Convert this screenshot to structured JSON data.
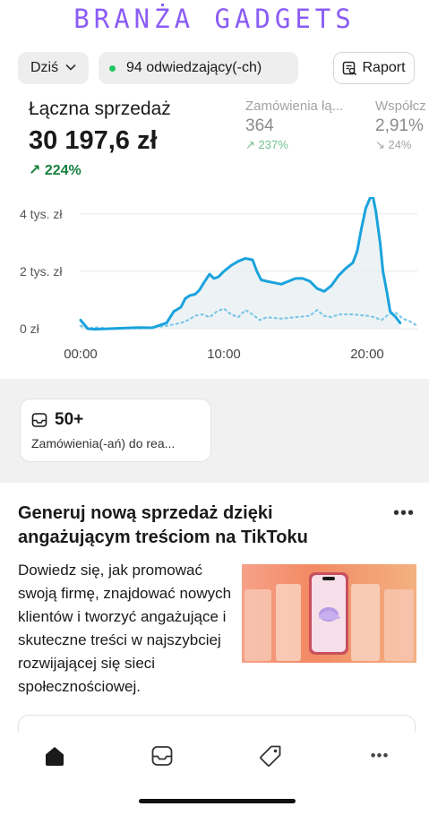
{
  "brand": "BRANŻA GADGETS",
  "toolbar": {
    "date_label": "Dziś",
    "visitors_label": "94 odwiedzający(-ch)",
    "report_label": "Raport"
  },
  "metrics": {
    "main": {
      "label": "Łączna sprzedaż",
      "value": "30 197,6 zł",
      "delta": "224%"
    },
    "orders": {
      "label": "Zamówienia łą...",
      "value": "364",
      "delta": "237%"
    },
    "conversion": {
      "label": "Współcz",
      "value": "2,91%",
      "delta": "24%"
    }
  },
  "chart_data": {
    "type": "line",
    "ytick_labels": [
      "4 tys. zł",
      "2 tys. zł",
      "0 zł"
    ],
    "yticks": [
      4000,
      2000,
      0
    ],
    "xtick_labels": [
      "00:00",
      "10:00",
      "20:00"
    ],
    "xticks": [
      0,
      10,
      20
    ],
    "xlim": [
      0,
      23.5
    ],
    "ylim": [
      0,
      4400
    ],
    "series": [
      {
        "style": "solid",
        "color": "#1ba3dd",
        "x": [
          0,
          0.5,
          1,
          2,
          3,
          4,
          5,
          6,
          6.5,
          7,
          7.3,
          7.6,
          8,
          8.3,
          8.6,
          9,
          9.3,
          9.6,
          10,
          10.5,
          11,
          11.5,
          12,
          12.3,
          12.6,
          13,
          13.5,
          14,
          14.5,
          15,
          15.5,
          16,
          16.5,
          17,
          17.5,
          18,
          18.5,
          19,
          19.3,
          19.6,
          19.9,
          20.2,
          20.4,
          20.6,
          20.9,
          21.1,
          21.4,
          21.6,
          22,
          22.3
        ],
        "y": [
          300,
          0,
          -20,
          0,
          20,
          40,
          30,
          200,
          600,
          750,
          1050,
          1150,
          1200,
          1350,
          1600,
          1900,
          1750,
          1800,
          2000,
          2200,
          2350,
          2450,
          2400,
          2000,
          1700,
          1650,
          1600,
          1550,
          1650,
          1750,
          1750,
          1650,
          1400,
          1300,
          1500,
          1850,
          2100,
          2300,
          2700,
          3500,
          4200,
          4550,
          4600,
          4100,
          3000,
          2000,
          1200,
          600,
          400,
          200
        ]
      },
      {
        "style": "dotted",
        "color": "#7cc7e8",
        "x": [
          0,
          0.5,
          1,
          2,
          3,
          4,
          5,
          6,
          7,
          7.5,
          8,
          8.5,
          9,
          9.5,
          10,
          10.5,
          11,
          11.5,
          12,
          12.5,
          13,
          14,
          15,
          16,
          16.5,
          17,
          17.5,
          18,
          19,
          20,
          20.5,
          21,
          21.5,
          22,
          22.5,
          23,
          23.5
        ],
        "y": [
          100,
          0,
          50,
          0,
          20,
          10,
          40,
          100,
          200,
          300,
          450,
          500,
          400,
          600,
          700,
          500,
          400,
          650,
          500,
          300,
          400,
          350,
          400,
          450,
          650,
          450,
          400,
          500,
          500,
          450,
          400,
          300,
          500,
          550,
          350,
          250,
          100
        ]
      }
    ]
  },
  "orders_card": {
    "value": "50+",
    "label": "Zamówienia(-ań) do rea..."
  },
  "promo": {
    "title": "Generuj nową sprzedaż dzięki angażującym treściom na TikToku",
    "text": "Dowiedz się, jak promować swoją firmę, znajdować nowych klientów i tworzyć angażujące i skuteczne treści w najszybciej rozwijającej się sieci społecznościowej.",
    "more": "•••"
  },
  "nav": {
    "items": [
      "home-icon",
      "inbox-icon",
      "tag-icon",
      "more-icon"
    ],
    "more_label": "•••"
  },
  "colors": {
    "brand": "#8b5cf6",
    "positive": "#15803d",
    "chart_line": "#1ba3dd"
  }
}
